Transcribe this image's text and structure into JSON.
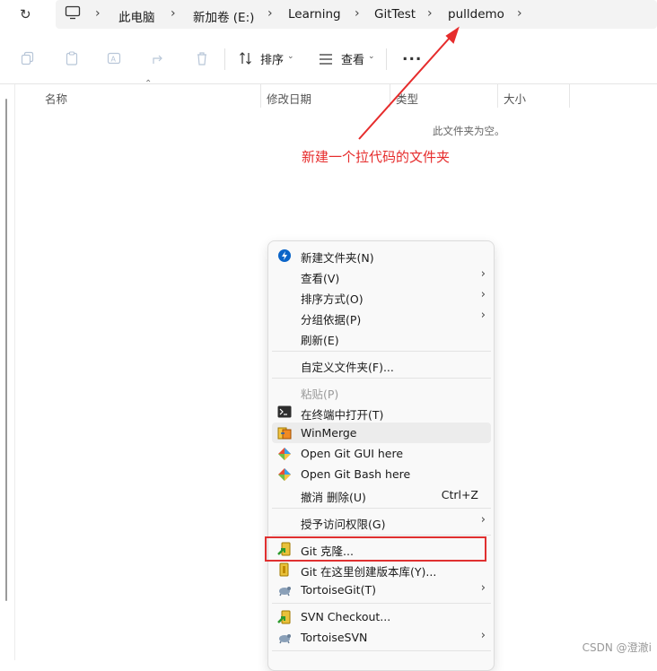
{
  "breadcrumbs": [
    "此电脑",
    "新加卷 (E:)",
    "Learning",
    "GitTest",
    "pulldemo"
  ],
  "toolbar": {
    "sort_label": "排序",
    "view_label": "查看",
    "more_label": "..."
  },
  "columns": [
    "名称",
    "修改日期",
    "类型",
    "大小"
  ],
  "empty_text": "此文件夹为空。",
  "annotation": "新建一个拉代码的文件夹",
  "menu": {
    "items": [
      {
        "label": "新建文件夹(N)",
        "icon": "new-folder-icon"
      },
      {
        "label": "查看(V)",
        "submenu": true
      },
      {
        "label": "排序方式(O)",
        "submenu": true
      },
      {
        "label": "分组依据(P)",
        "submenu": true
      },
      {
        "label": "刷新(E)"
      },
      {
        "label": "自定义文件夹(F)..."
      },
      {
        "label": "粘贴(P)",
        "disabled": true
      },
      {
        "label": "在终端中打开(T)",
        "icon": "terminal-icon"
      },
      {
        "label": "WinMerge",
        "icon": "winmerge-icon"
      },
      {
        "label": "Open Git GUI here",
        "icon": "git-icon"
      },
      {
        "label": "Open Git Bash here",
        "icon": "git-icon"
      },
      {
        "label": "撤消 删除(U)",
        "shortcut": "Ctrl+Z"
      },
      {
        "label": "授予访问权限(G)",
        "submenu": true
      },
      {
        "label": "Git 克隆...",
        "icon": "git-clone-icon"
      },
      {
        "label": "Git 在这里创建版本库(Y)...",
        "icon": "git-create-repo-icon"
      },
      {
        "label": "TortoiseGit(T)",
        "icon": "tortoise-icon",
        "submenu": true
      },
      {
        "label": "SVN Checkout...",
        "icon": "svn-checkout-icon"
      },
      {
        "label": "TortoiseSVN",
        "icon": "tortoise-icon",
        "submenu": true
      }
    ]
  },
  "watermark": "CSDN @澄澈i",
  "colors": {
    "annotation": "#e62c2c",
    "menu_bg": "#f9f9f9",
    "highlight": "#ececec"
  }
}
